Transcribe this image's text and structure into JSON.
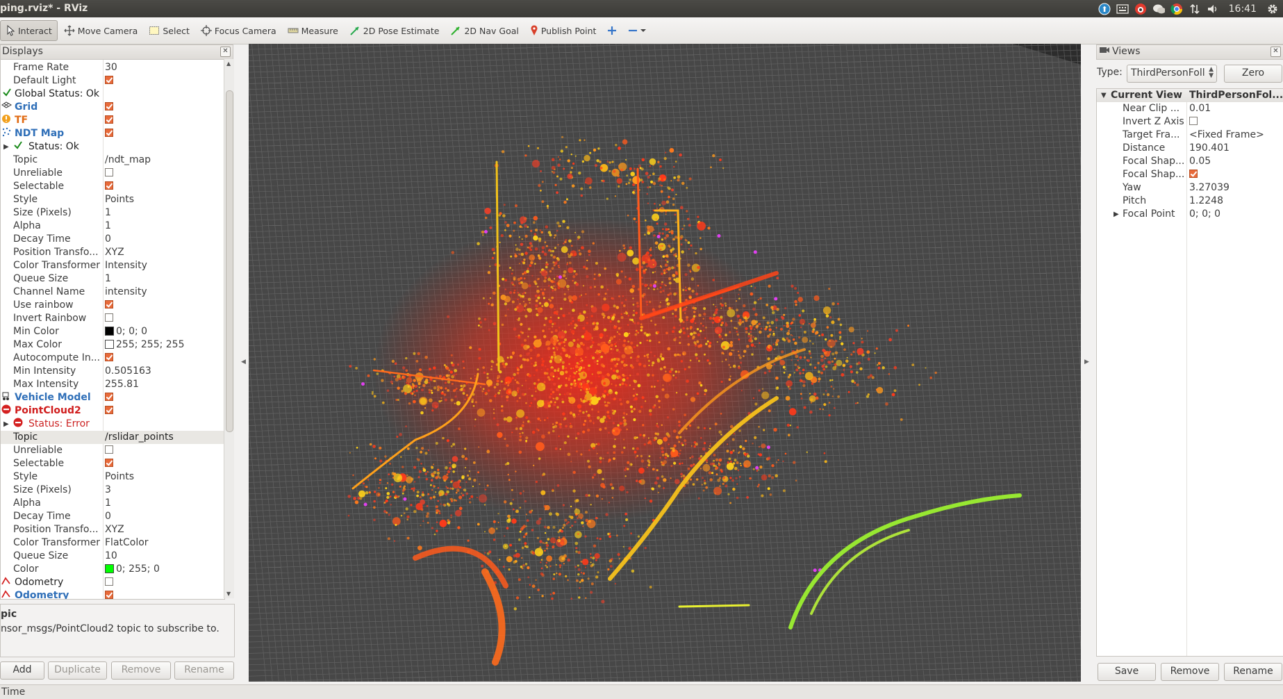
{
  "window": {
    "title": "ping.rviz* - RViz"
  },
  "tray": {
    "clock": "16:41"
  },
  "toolbar": {
    "tools": [
      {
        "label": "Interact"
      },
      {
        "label": "Move Camera"
      },
      {
        "label": "Select"
      },
      {
        "label": "Focus Camera"
      },
      {
        "label": "Measure"
      },
      {
        "label": "2D Pose Estimate"
      },
      {
        "label": "2D Nav Goal"
      },
      {
        "label": "Publish Point"
      }
    ]
  },
  "displays": {
    "title": "Displays",
    "rows": [
      {
        "k": "Frame Rate",
        "v": "30"
      },
      {
        "k": "Default Light"
      },
      {
        "k": "Global Status: Ok"
      },
      {
        "k": "Grid"
      },
      {
        "k": "TF"
      },
      {
        "k": "NDT Map"
      },
      {
        "k": "Status: Ok"
      },
      {
        "k": "Topic",
        "v": "/ndt_map"
      },
      {
        "k": "Unreliable"
      },
      {
        "k": "Selectable"
      },
      {
        "k": "Style",
        "v": "Points"
      },
      {
        "k": "Size (Pixels)",
        "v": "1"
      },
      {
        "k": "Alpha",
        "v": "1"
      },
      {
        "k": "Decay Time",
        "v": "0"
      },
      {
        "k": "Position Transfo...",
        "v": "XYZ"
      },
      {
        "k": "Color Transformer",
        "v": "Intensity"
      },
      {
        "k": "Queue Size",
        "v": "1"
      },
      {
        "k": "Channel Name",
        "v": "intensity"
      },
      {
        "k": "Use rainbow"
      },
      {
        "k": "Invert Rainbow"
      },
      {
        "k": "Min Color",
        "v": "0; 0; 0"
      },
      {
        "k": "Max Color",
        "v": "255; 255; 255"
      },
      {
        "k": "Autocompute In..."
      },
      {
        "k": "Min Intensity",
        "v": "0.505163"
      },
      {
        "k": "Max Intensity",
        "v": "255.81"
      },
      {
        "k": "Vehicle Model"
      },
      {
        "k": "PointCloud2"
      },
      {
        "k": "Status: Error"
      },
      {
        "k": "Topic",
        "v": "/rslidar_points"
      },
      {
        "k": "Unreliable"
      },
      {
        "k": "Selectable"
      },
      {
        "k": "Style",
        "v": "Points"
      },
      {
        "k": "Size (Pixels)",
        "v": "3"
      },
      {
        "k": "Alpha",
        "v": "1"
      },
      {
        "k": "Decay Time",
        "v": "0"
      },
      {
        "k": "Position Transfo...",
        "v": "XYZ"
      },
      {
        "k": "Color Transformer",
        "v": "FlatColor"
      },
      {
        "k": "Queue Size",
        "v": "10"
      },
      {
        "k": "Color",
        "v": "0; 255; 0"
      },
      {
        "k": "Odometry"
      },
      {
        "k": "Odometry"
      }
    ],
    "colors": {
      "min_color": "#000000",
      "max_color": "#ffffff",
      "color": "#00ff00",
      "accent": "#e86a3a"
    }
  },
  "help": {
    "title": "pic",
    "text": "nsor_msgs/PointCloud2 topic to subscribe to."
  },
  "display_buttons": {
    "add": "Add",
    "duplicate": "Duplicate",
    "remove": "Remove",
    "rename": "Rename"
  },
  "views": {
    "title": "Views",
    "type_label": "Type:",
    "type_value": "ThirdPersonFoll",
    "zero": "Zero",
    "header_key": "Current View",
    "header_value": "ThirdPersonFol...",
    "rows": [
      {
        "k": "Near Clip ...",
        "v": "0.01"
      },
      {
        "k": "Invert Z Axis"
      },
      {
        "k": "Target Fra...",
        "v": "<Fixed Frame>"
      },
      {
        "k": "Distance",
        "v": "190.401"
      },
      {
        "k": "Focal Shap...",
        "v": "0.05"
      },
      {
        "k": "Focal Shap..."
      },
      {
        "k": "Yaw",
        "v": "3.27039"
      },
      {
        "k": "Pitch",
        "v": "1.2248"
      },
      {
        "k": "Focal Point",
        "v": "0; 0; 0"
      }
    ],
    "buttons": {
      "save": "Save",
      "remove": "Remove",
      "rename": "Rename"
    }
  },
  "status_bar": {
    "label": "Time"
  }
}
